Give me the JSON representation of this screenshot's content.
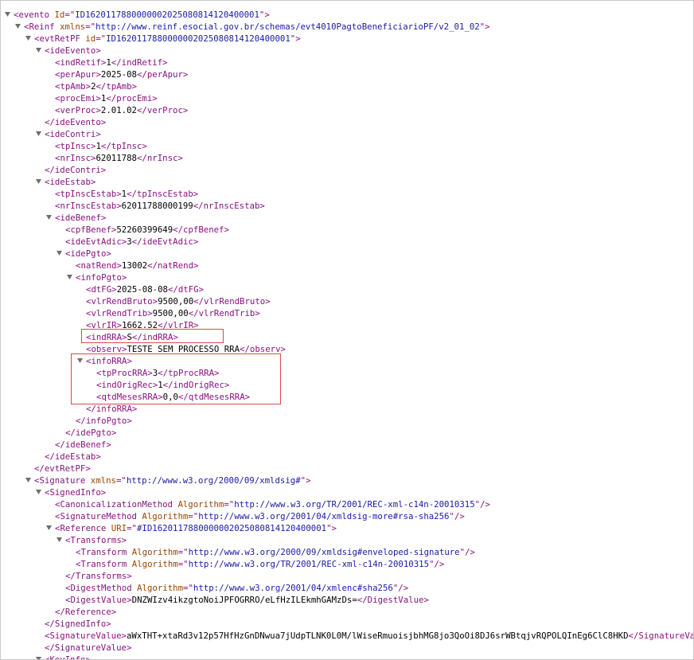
{
  "colors": {
    "tag": "#881280",
    "attr_name": "#994500",
    "attr_value": "#1a1aa6",
    "text": "#000000",
    "highlight": "#e04848",
    "toggle": "#6e6e6e"
  },
  "toggle_icon": "expanded-triangle-icon",
  "lines": [
    {
      "ind": 0,
      "kind": "open",
      "tag": "evento",
      "attrs": [
        {
          "n": "Id",
          "v": "ID1620117880000002025080814120400001"
        }
      ],
      "toggle": true
    },
    {
      "ind": 1,
      "kind": "open",
      "tag": "Reinf",
      "attrs": [
        {
          "n": "xmlns",
          "v": "http://www.reinf.esocial.gov.br/schemas/evt4010PagtoBeneficiarioPF/v2_01_02"
        }
      ],
      "toggle": true
    },
    {
      "ind": 2,
      "kind": "open",
      "tag": "evtRetPF",
      "attrs": [
        {
          "n": "id",
          "v": "ID1620117880000002025080814120400001"
        }
      ],
      "toggle": true
    },
    {
      "ind": 3,
      "kind": "open",
      "tag": "ideEvento",
      "attrs": [],
      "toggle": true
    },
    {
      "ind": 4,
      "kind": "leaf",
      "tag": "indRetif",
      "text": "1"
    },
    {
      "ind": 4,
      "kind": "leaf",
      "tag": "perApur",
      "text": "2025-08"
    },
    {
      "ind": 4,
      "kind": "leaf",
      "tag": "tpAmb",
      "text": "2"
    },
    {
      "ind": 4,
      "kind": "leaf",
      "tag": "procEmi",
      "text": "1"
    },
    {
      "ind": 4,
      "kind": "leaf",
      "tag": "verProc",
      "text": "2.01.02"
    },
    {
      "ind": 3,
      "kind": "close",
      "tag": "ideEvento"
    },
    {
      "ind": 3,
      "kind": "open",
      "tag": "ideContri",
      "attrs": [],
      "toggle": true
    },
    {
      "ind": 4,
      "kind": "leaf",
      "tag": "tpInsc",
      "text": "1"
    },
    {
      "ind": 4,
      "kind": "leaf",
      "tag": "nrInsc",
      "text": "62011788"
    },
    {
      "ind": 3,
      "kind": "close",
      "tag": "ideContri"
    },
    {
      "ind": 3,
      "kind": "open",
      "tag": "ideEstab",
      "attrs": [],
      "toggle": true
    },
    {
      "ind": 4,
      "kind": "leaf",
      "tag": "tpInscEstab",
      "text": "1"
    },
    {
      "ind": 4,
      "kind": "leaf",
      "tag": "nrInscEstab",
      "text": "62011788000199"
    },
    {
      "ind": 4,
      "kind": "open",
      "tag": "ideBenef",
      "attrs": [],
      "toggle": true
    },
    {
      "ind": 5,
      "kind": "leaf",
      "tag": "cpfBenef",
      "text": "52260399649"
    },
    {
      "ind": 5,
      "kind": "leaf",
      "tag": "ideEvtAdic",
      "text": "3"
    },
    {
      "ind": 5,
      "kind": "open",
      "tag": "idePgto",
      "attrs": [],
      "toggle": true
    },
    {
      "ind": 6,
      "kind": "leaf",
      "tag": "natRend",
      "text": "13002"
    },
    {
      "ind": 6,
      "kind": "open",
      "tag": "infoPgto",
      "attrs": [],
      "toggle": true
    },
    {
      "ind": 7,
      "kind": "leaf",
      "tag": "dtFG",
      "text": "2025-08-08"
    },
    {
      "ind": 7,
      "kind": "leaf",
      "tag": "vlrRendBruto",
      "text": "9500,00"
    },
    {
      "ind": 7,
      "kind": "leaf",
      "tag": "vlrRendTrib",
      "text": "9500,00"
    },
    {
      "ind": 7,
      "kind": "leaf",
      "tag": "vlrIR",
      "text": "1662.52"
    },
    {
      "ind": 7,
      "kind": "leaf",
      "tag": "indRRA",
      "text": "S"
    },
    {
      "ind": 7,
      "kind": "leaf",
      "tag": "observ",
      "text": "TESTE SEM PROCESSO RRA"
    },
    {
      "ind": 7,
      "kind": "open",
      "tag": "infoRRA",
      "attrs": [],
      "toggle": true
    },
    {
      "ind": 8,
      "kind": "leaf",
      "tag": "tpProcRRA",
      "text": "3"
    },
    {
      "ind": 8,
      "kind": "leaf",
      "tag": "indOrigRec",
      "text": "1"
    },
    {
      "ind": 8,
      "kind": "leaf",
      "tag": "qtdMesesRRA",
      "text": "0,0"
    },
    {
      "ind": 7,
      "kind": "close",
      "tag": "infoRRA"
    },
    {
      "ind": 6,
      "kind": "close",
      "tag": "infoPgto"
    },
    {
      "ind": 5,
      "kind": "close",
      "tag": "idePgto"
    },
    {
      "ind": 4,
      "kind": "close",
      "tag": "ideBenef"
    },
    {
      "ind": 3,
      "kind": "close",
      "tag": "ideEstab"
    },
    {
      "ind": 2,
      "kind": "close",
      "tag": "evtRetPF"
    },
    {
      "ind": 2,
      "kind": "open",
      "tag": "Signature",
      "attrs": [
        {
          "n": "xmlns",
          "v": "http://www.w3.org/2000/09/xmldsig#"
        }
      ],
      "toggle": true
    },
    {
      "ind": 3,
      "kind": "open",
      "tag": "SignedInfo",
      "attrs": [],
      "toggle": true
    },
    {
      "ind": 4,
      "kind": "selfclose",
      "tag": "CanonicalizationMethod",
      "attrs": [
        {
          "n": "Algorithm",
          "v": "http://www.w3.org/TR/2001/REC-xml-c14n-20010315"
        }
      ]
    },
    {
      "ind": 4,
      "kind": "selfclose",
      "tag": "SignatureMethod",
      "attrs": [
        {
          "n": "Algorithm",
          "v": "http://www.w3.org/2001/04/xmldsig-more#rsa-sha256"
        }
      ]
    },
    {
      "ind": 4,
      "kind": "open",
      "tag": "Reference",
      "attrs": [
        {
          "n": "URI",
          "v": "#ID1620117880000002025080814120400001"
        }
      ],
      "toggle": true
    },
    {
      "ind": 5,
      "kind": "open",
      "tag": "Transforms",
      "attrs": [],
      "toggle": true
    },
    {
      "ind": 6,
      "kind": "selfclose",
      "tag": "Transform",
      "attrs": [
        {
          "n": "Algorithm",
          "v": "http://www.w3.org/2000/09/xmldsig#enveloped-signature"
        }
      ]
    },
    {
      "ind": 6,
      "kind": "selfclose",
      "tag": "Transform",
      "attrs": [
        {
          "n": "Algorithm",
          "v": "http://www.w3.org/TR/2001/REC-xml-c14n-20010315"
        }
      ]
    },
    {
      "ind": 5,
      "kind": "close",
      "tag": "Transforms"
    },
    {
      "ind": 5,
      "kind": "selfclose",
      "tag": "DigestMethod",
      "attrs": [
        {
          "n": "Algorithm",
          "v": "http://www.w3.org/2001/04/xmlenc#sha256"
        }
      ]
    },
    {
      "ind": 5,
      "kind": "leaf",
      "tag": "DigestValue",
      "text": "DNZWIzv4ikzgtoNoiJPFOGRRO/eLfHzILEkmhGAMzDs="
    },
    {
      "ind": 4,
      "kind": "close",
      "tag": "Reference"
    },
    {
      "ind": 3,
      "kind": "close",
      "tag": "SignedInfo"
    },
    {
      "ind": 3,
      "kind": "leaf",
      "tag": "SignatureValue",
      "text": "aWxTHT+xtaRd3v12p57HfHzGnDNwua7jUdpTLNK0L0M/lWiseRmuoisjbhMG8jo3QoOi8DJ6srWBtqjvRQPOLQInEg6ClC8HKD"
    },
    {
      "ind": 3,
      "kind": "close",
      "tag": "SignatureValue"
    },
    {
      "ind": 3,
      "kind": "open",
      "tag": "KeyInfo",
      "attrs": [],
      "toggle": true
    }
  ]
}
